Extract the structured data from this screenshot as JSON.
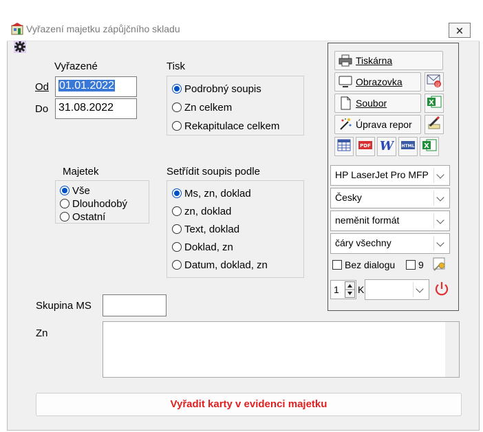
{
  "window": {
    "title": "Vyřazení majetku zápůjčního skladu",
    "close_glyph": "🗙"
  },
  "date_range": {
    "heading": "Vyřazené",
    "from_label": "Od",
    "from_value": "01.01.2022",
    "to_label": "Do",
    "to_value": "31.08.2022"
  },
  "print_mode": {
    "heading": "Tisk",
    "options": [
      "Podrobný soupis",
      "Zn celkem",
      "Rekapitulace celkem"
    ],
    "selected": 0
  },
  "asset_type": {
    "heading": "Majetek",
    "options": [
      "Vše",
      "Dlouhodobý",
      "Ostatní"
    ],
    "selected": 0
  },
  "sort_by": {
    "heading": "Setřídit soupis podle",
    "options": [
      "Ms, zn, doklad",
      "zn, doklad",
      "Text, doklad",
      "Doklad, zn",
      "Datum, doklad, zn"
    ],
    "selected": 0
  },
  "group_ms": {
    "label": "Skupina MS",
    "value": ""
  },
  "zn": {
    "label": "Zn",
    "value": ""
  },
  "output_panel": {
    "printer_button": "Tiskárna",
    "screen_button": "Obrazovka",
    "file_button": "Soubor",
    "edit_report_button": "Úprava repor",
    "printer_select": "HP LaserJet Pro MFP",
    "language_select": "Česky",
    "format_select": "neměnit formát",
    "lines_select": "čáry všechny",
    "no_dialog_label": "Bez dialogu",
    "nine_label": "9",
    "copies_value": "1",
    "k_label": "K",
    "k_select": ""
  },
  "action_button": "Vyřadit karty v evidenci majetku",
  "colors": {
    "accent": "#0050c8",
    "action_text": "#e02020",
    "selection": "#3a78d8",
    "excel_green": "#1f8f3a",
    "power_red": "#e03030"
  }
}
